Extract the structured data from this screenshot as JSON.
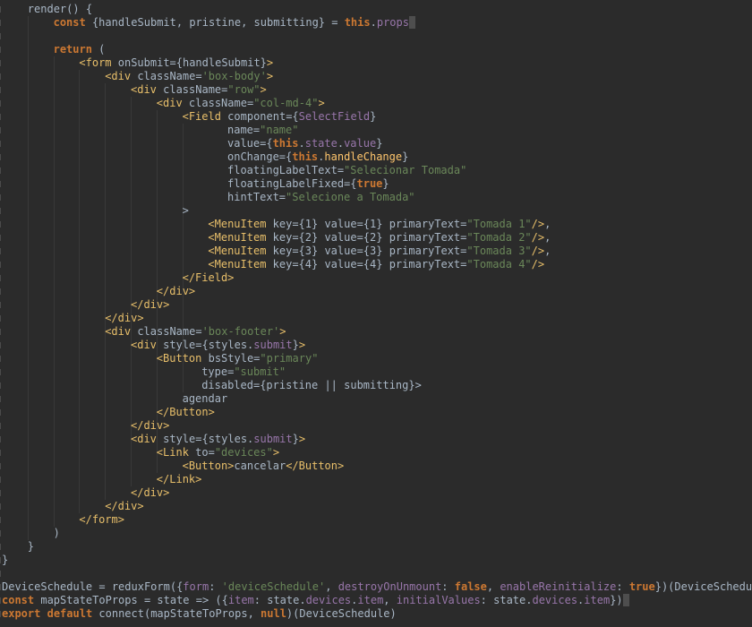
{
  "editor": {
    "language": "jsx",
    "theme_colors": {
      "background": "#2b2b2b",
      "text": "#a9b7c6",
      "keyword": "#cc7832",
      "tag": "#e8bf6a",
      "string": "#6a8759",
      "property": "#9876aa",
      "function": "#ffc66d"
    },
    "lines": [
      "render() {",
      "const {handleSubmit, pristine, submitting} = this.props",
      "",
      "return (",
      "<form onSubmit={handleSubmit}>",
      "<div className='box-body'>",
      "<div className=\"row\">",
      "<div className=\"col-md-4\">",
      "<Field component={SelectField}",
      "name=\"name\"",
      "value={this.state.value}",
      "onChange={this.handleChange}",
      "floatingLabelText=\"Selecionar Tomada\"",
      "floatingLabelFixed={true}",
      "hintText=\"Selecione a Tomada\"",
      ">",
      "<MenuItem key={1} value={1} primaryText=\"Tomada 1\"/>,",
      "<MenuItem key={2} value={2} primaryText=\"Tomada 2\"/>,",
      "<MenuItem key={3} value={3} primaryText=\"Tomada 3\"/>,",
      "<MenuItem key={4} value={4} primaryText=\"Tomada 4\"/>",
      "</Field>",
      "</div>",
      "</div>",
      "</div>",
      "<div className='box-footer'>",
      "<div style={styles.submit}>",
      "<Button bsStyle=\"primary\"",
      "type=\"submit\"",
      "disabled={pristine || submitting}>",
      "agendar",
      "</Button>",
      "</div>",
      "<div style={styles.submit}>",
      "<Link to=\"devices\">",
      "<Button>cancelar</Button>",
      "</Link>",
      "</div>",
      "</div>",
      "</form>",
      ")",
      "}",
      "}",
      "",
      "DeviceSchedule = reduxForm({form: 'deviceSchedule', destroyOnUnmount: false, enableReinitialize: true})(DeviceSchedule)",
      "const mapStateToProps = state => ({item: state.devices.item, initialValues: state.devices.item})",
      "export default connect(mapStateToProps, null)(DeviceSchedule)"
    ]
  }
}
